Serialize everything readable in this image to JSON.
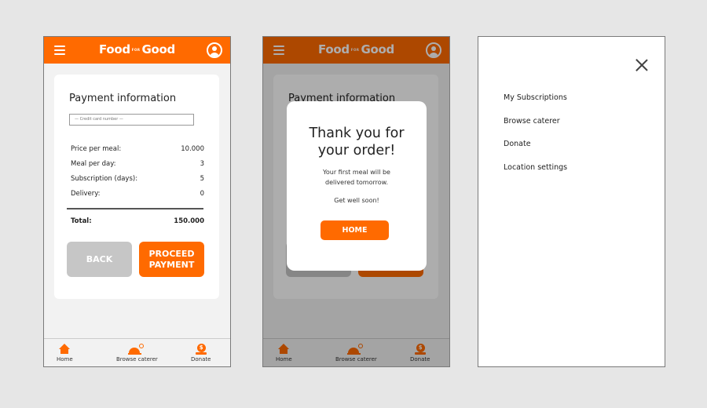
{
  "brand": {
    "name_left": "Food",
    "name_small": "FOR",
    "name_right": "Good",
    "color": "#ff6a00"
  },
  "payment": {
    "title": "Payment information",
    "cc_placeholder": "— Credit card number —",
    "rows": [
      {
        "label": "Price per meal:",
        "value": "10.000"
      },
      {
        "label": "Meal per day:",
        "value": "3"
      },
      {
        "label": "Subscription (days):",
        "value": "5"
      },
      {
        "label": "Delivery:",
        "value": "0"
      }
    ],
    "total_label": "Total:",
    "total_value": "150.000",
    "back_label": "BACK",
    "proceed_label_1": "PROCEED",
    "proceed_label_2": "PAYMENT"
  },
  "tabs": {
    "home": "Home",
    "browse": "Browse caterer",
    "donate": "Donate"
  },
  "modal": {
    "title_1": "Thank you for",
    "title_2": "your order!",
    "message_1": "Your first meal will be",
    "message_2": "delivered tomorrow.",
    "sub": "Get well soon!",
    "button": "HOME"
  },
  "menu": {
    "items": [
      "My Subscriptions",
      "Browse caterer",
      "Donate",
      "Location settings"
    ]
  }
}
